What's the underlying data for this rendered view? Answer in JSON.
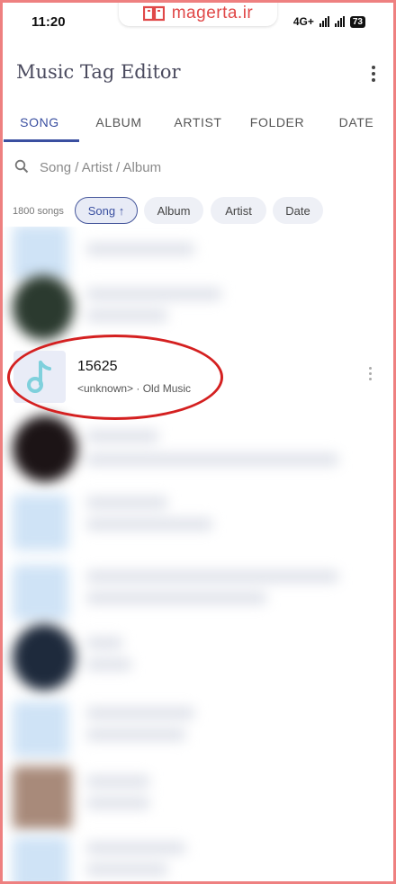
{
  "status_bar": {
    "time": "11:20",
    "network": "4G+",
    "battery": "73"
  },
  "watermark": {
    "text": "magerta.ir",
    "color": "#e04848"
  },
  "app_bar": {
    "title": "Music Tag Editor"
  },
  "tabs": [
    {
      "label": "SONG",
      "active": true
    },
    {
      "label": "ALBUM",
      "active": false
    },
    {
      "label": "ARTIST",
      "active": false
    },
    {
      "label": "FOLDER",
      "active": false
    },
    {
      "label": "DATE",
      "active": false
    }
  ],
  "search": {
    "placeholder": "Song / Artist / Album"
  },
  "filter": {
    "count": "1800 songs",
    "chips": [
      {
        "label": "Song ↑",
        "active": true
      },
      {
        "label": "Album",
        "active": false
      },
      {
        "label": "Artist",
        "active": false
      },
      {
        "label": "Date",
        "active": false
      }
    ]
  },
  "song_list": {
    "highlighted": {
      "title": "15625",
      "subtitle": "<unknown> · Old Music",
      "icon": "music-note-icon"
    }
  },
  "colors": {
    "accent": "#3a4fa0",
    "highlight_ring": "#d42020",
    "frame": "#ee8080",
    "music_icon": "#7fd0dc"
  }
}
